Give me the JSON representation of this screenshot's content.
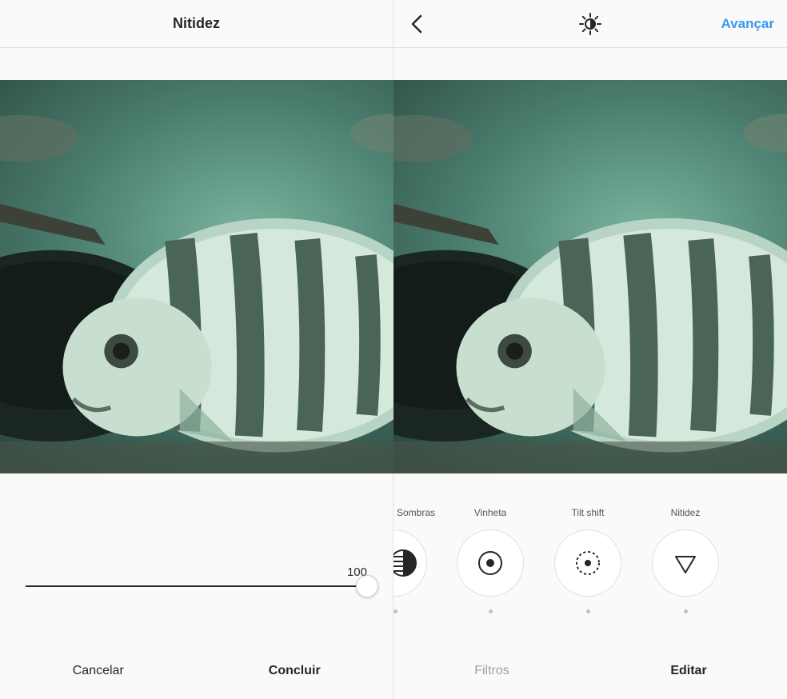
{
  "left": {
    "title": "Nitidez",
    "slider_value": "100",
    "cancel_label": "Cancelar",
    "done_label": "Concluir"
  },
  "right": {
    "action": "Avançar",
    "tools": [
      {
        "label": "Sombras",
        "icon": "shadows"
      },
      {
        "label": "Vinheta",
        "icon": "vignette"
      },
      {
        "label": "Tilt shift",
        "icon": "tiltshift"
      },
      {
        "label": "Nitidez",
        "icon": "sharpen"
      }
    ],
    "tab_filters": "Filtros",
    "tab_edit": "Editar"
  }
}
